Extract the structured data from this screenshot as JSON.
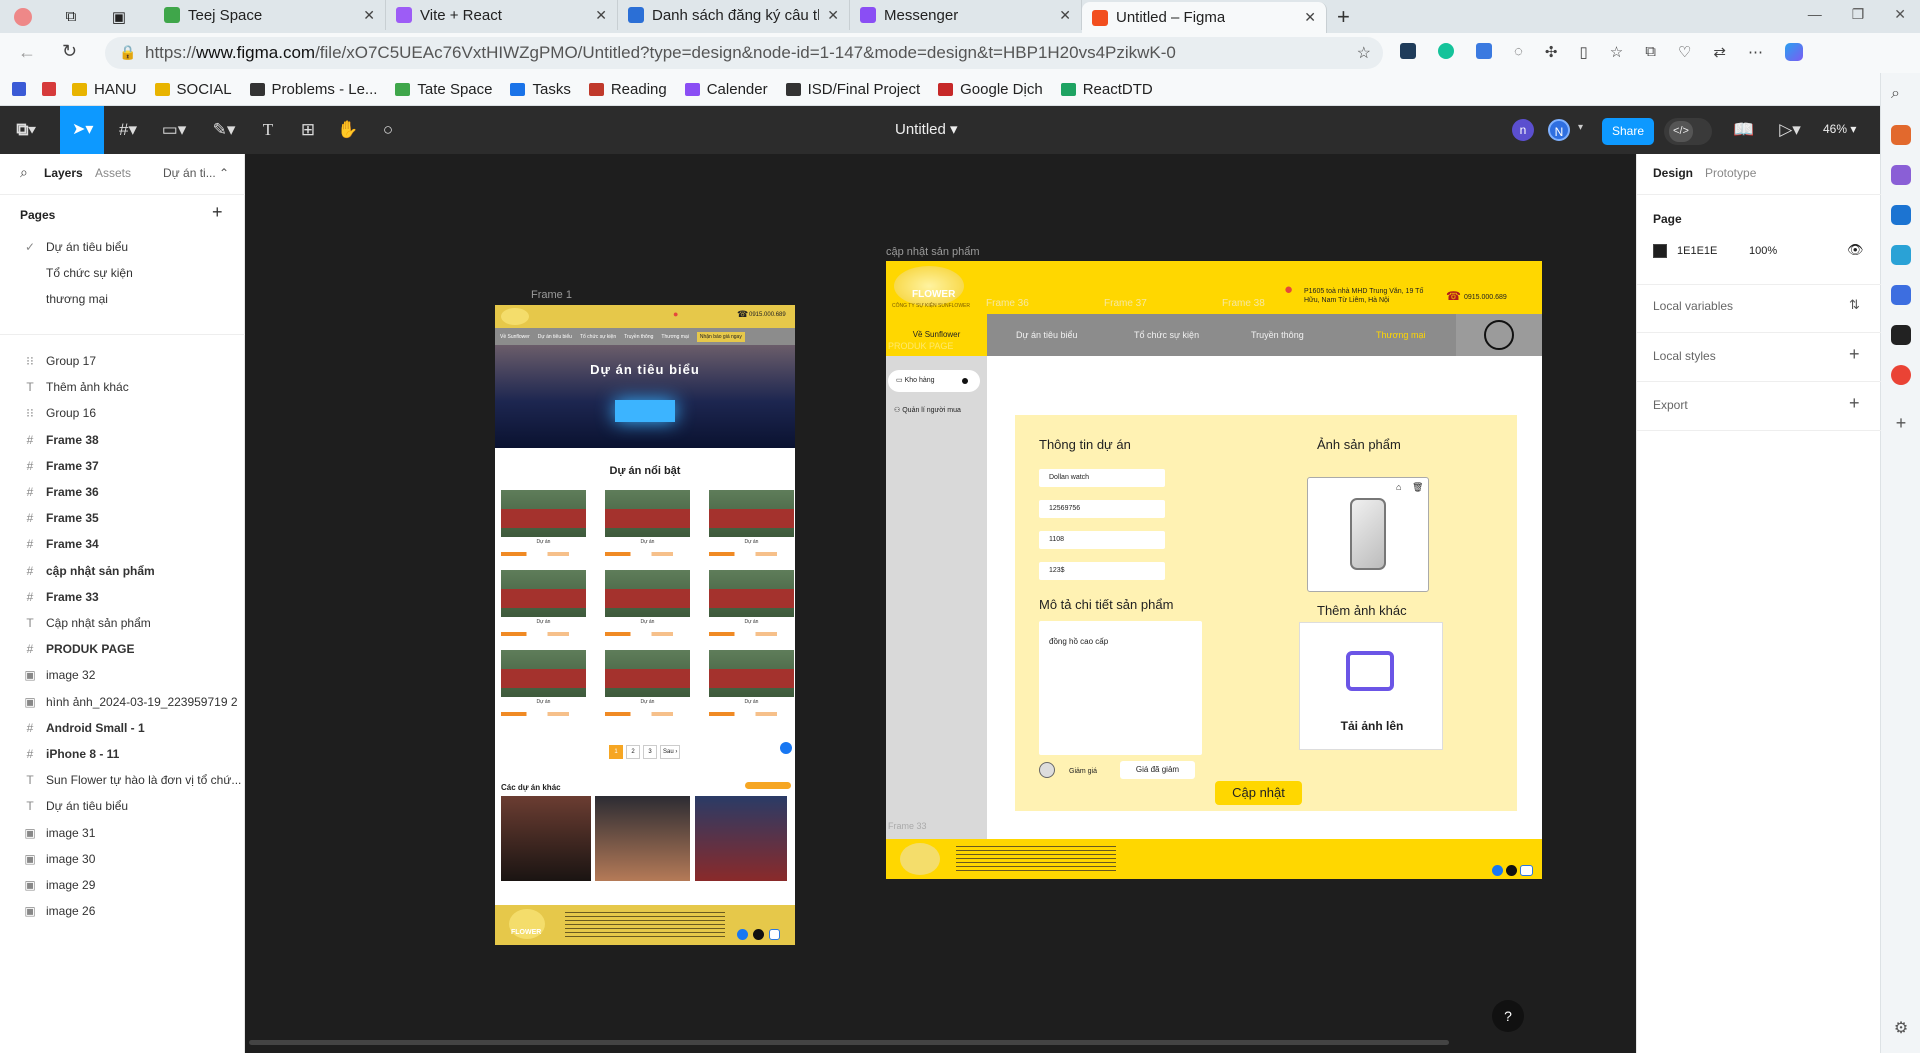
{
  "browser": {
    "tabs": [
      {
        "title": "Teej Space",
        "color": "#3fa64a"
      },
      {
        "title": "Vite + React",
        "color": "#9d5cf6"
      },
      {
        "title": "Danh sách đăng ký câu th",
        "color": "#2b6fd6"
      },
      {
        "title": "Messenger",
        "color": "#8a4ef4"
      },
      {
        "title": "Untitled – Figma",
        "color": "#f24e1e"
      }
    ],
    "url_prefix": "https://",
    "url_host": "www.figma.com",
    "url_path": "/file/xO7C5UEAc76VxtHIWZgPMO/Untitled?type=design&node-id=1-147&mode=design&t=HBP1H20vs4PzikwK-0",
    "bookmarks": [
      "HANU",
      "SOCIAL",
      "Problems - Le...",
      "Tate Space",
      "Tasks",
      "Reading",
      "Calender",
      "ISD/Final Project",
      "Google Dịch",
      "ReactDTD"
    ]
  },
  "figma": {
    "file_title": "Untitled",
    "avatars": [
      "n",
      "N"
    ],
    "share_label": "Share",
    "zoom": "46%",
    "left_tabs": {
      "layers": "Layers",
      "assets": "Assets",
      "page_selector": "Dự án ti..."
    },
    "pages_heading": "Pages",
    "pages": [
      "Dự án tiêu biểu",
      "Tổ chức sự kiện",
      "thương mại"
    ],
    "layers": [
      {
        "name": "Group 17",
        "type": "group"
      },
      {
        "name": "Thêm ảnh khác",
        "type": "text"
      },
      {
        "name": "Group 16",
        "type": "group"
      },
      {
        "name": "Frame 38",
        "type": "frame"
      },
      {
        "name": "Frame 37",
        "type": "frame"
      },
      {
        "name": "Frame 36",
        "type": "frame"
      },
      {
        "name": "Frame 35",
        "type": "frame"
      },
      {
        "name": "Frame 34",
        "type": "frame"
      },
      {
        "name": "cập nhật sản phẩm",
        "type": "frame"
      },
      {
        "name": "Frame 33",
        "type": "frame"
      },
      {
        "name": "Cập nhật sản phẩm",
        "type": "text"
      },
      {
        "name": "PRODUK PAGE",
        "type": "frame"
      },
      {
        "name": "image 32",
        "type": "image"
      },
      {
        "name": "hình ảnh_2024-03-19_223959719 2",
        "type": "image"
      },
      {
        "name": "Android Small - 1",
        "type": "frame"
      },
      {
        "name": "iPhone 8 - 11",
        "type": "frame"
      },
      {
        "name": "Sun Flower tự hào là đơn vị tổ chứ...",
        "type": "text"
      },
      {
        "name": "Dự án tiêu biểu",
        "type": "text"
      },
      {
        "name": "image 31",
        "type": "image"
      },
      {
        "name": "image 30",
        "type": "image"
      },
      {
        "name": "image 29",
        "type": "image"
      },
      {
        "name": "image 26",
        "type": "image"
      }
    ],
    "right": {
      "tabs": [
        "Design",
        "Prototype"
      ],
      "page_label": "Page",
      "page_color": "1E1E1E",
      "page_opacity": "100%",
      "sections": [
        "Local variables",
        "Local styles",
        "Export"
      ]
    }
  },
  "frame1": {
    "label": "Frame 1",
    "phone": "0915.000.689",
    "nav": [
      "Về Sunflower",
      "Dự án tiêu biểu",
      "Tổ chức sự kiện",
      "Truyền thông",
      "Thương mại",
      "Nhận báo giá ngay"
    ],
    "hero_title": "Dự án tiêu biểu",
    "featured_title": "Dự án nổi bật",
    "project_caption": "Dự án",
    "pagination": [
      "1",
      "2",
      "3",
      "Sau ›"
    ],
    "other_title": "Các dự án khác",
    "logo_text": "FLOWER"
  },
  "frame2": {
    "label": "cập nhật sản phẩm",
    "logo_text": "FLOWER",
    "logo_sub": "CÔNG TY SỰ KIỆN SUNFLOWER",
    "address": "P1605 toà nhà MHD Trung Văn, 19 Tố Hữu, Nam Từ Liêm, Hà Nội",
    "phone": "0915.000.689",
    "nav_active": "Về Sunflower",
    "nav": [
      "Dự án tiêu biểu",
      "Tổ chức sự kiện",
      "Truyền thông",
      "Thương mại"
    ],
    "ghost_labels": [
      "Frame 36",
      "Frame 37",
      "Frame 38",
      "PRODUK PAGE",
      "Frame 33"
    ],
    "sidebar": [
      "Kho hàng",
      "Quản lí người mua"
    ],
    "info_title": "Thông tin dự án",
    "fields": [
      "Dollan watch",
      "12569756",
      "1108",
      "123$"
    ],
    "desc_title": "Mô tả chi tiết sản phẩm",
    "desc_value": "đồng hồ cao cấp",
    "discount_label": "Giảm giá",
    "discount_price": "Giá đã giảm",
    "image_title": "Ảnh sản phẩm",
    "more_images_title": "Thêm ảnh khác",
    "upload_label": "Tải ảnh lên",
    "update_button": "Cập nhật"
  }
}
